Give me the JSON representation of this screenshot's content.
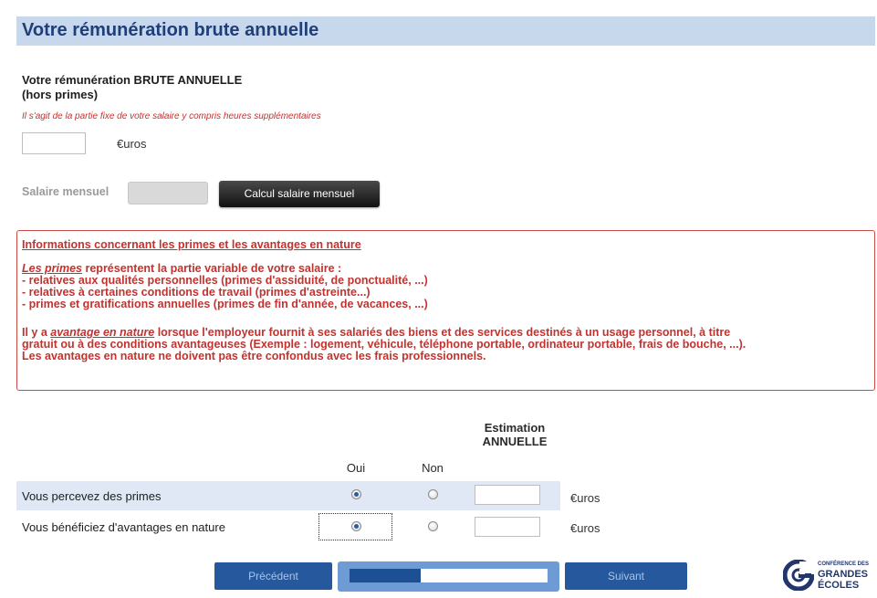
{
  "page_title": "Votre rémunération brute annuelle",
  "salary": {
    "heading_line1": "Votre rémunération BRUTE ANNUELLE",
    "heading_line2": "(hors primes)",
    "note": "Il s'agit de la partie fixe de votre salaire y compris heures supplémentaires",
    "value": "",
    "unit": "€uros"
  },
  "monthly": {
    "label": "Salaire mensuel",
    "value": "",
    "button_label": "Calcul salaire mensuel"
  },
  "info": {
    "heading": "Informations concernant les primes et les avantages en nature",
    "primes_term": "Les primes",
    "primes_intro": " représentent la partie variable de votre salaire :",
    "primes_items": [
      "- relatives aux qualités personnelles (primes d'assiduité, de ponctualité, ...)",
      "- relatives à certaines conditions de travail (primes d'astreinte...)",
      "- primes et gratifications annuelles (primes de fin d'année, de vacances, ...)"
    ],
    "avantage_prefix": "Il y a ",
    "avantage_term": "avantage en nature",
    "avantage_line1": " lorsque l'employeur fournit à ses salariés des biens et des services destinés à un usage personnel, à titre",
    "avantage_line2": "gratuit ou à des conditions avantageuses (Exemple : logement, véhicule, téléphone portable, ordinateur portable, frais de bouche, ...).",
    "avantage_line3": "Les avantages en nature ne doivent pas être confondus avec les frais professionnels."
  },
  "table": {
    "col_oui": "Oui",
    "col_non": "Non",
    "col_estimation_line1": "Estimation",
    "col_estimation_line2": "ANNUELLE",
    "rows": [
      {
        "label": "Vous percevez des primes",
        "selected": "oui",
        "value": "",
        "unit": "€uros"
      },
      {
        "label": "Vous bénéficiez d'avantages en nature",
        "selected": "oui",
        "value": "",
        "unit": "€uros"
      }
    ]
  },
  "nav": {
    "prev_label": "Précédent",
    "next_label": "Suivant",
    "progress": 0.36
  },
  "logo": {
    "line1": "CONFÉRENCE DES",
    "line2": "GRANDES",
    "line3": "ÉCOLES"
  },
  "colors": {
    "title_bar": "#c8d8ec",
    "title_text": "#1f3e7a",
    "info_red": "#c2332f",
    "nav_blue": "#25589d",
    "row_highlight": "#dfe8f4"
  }
}
